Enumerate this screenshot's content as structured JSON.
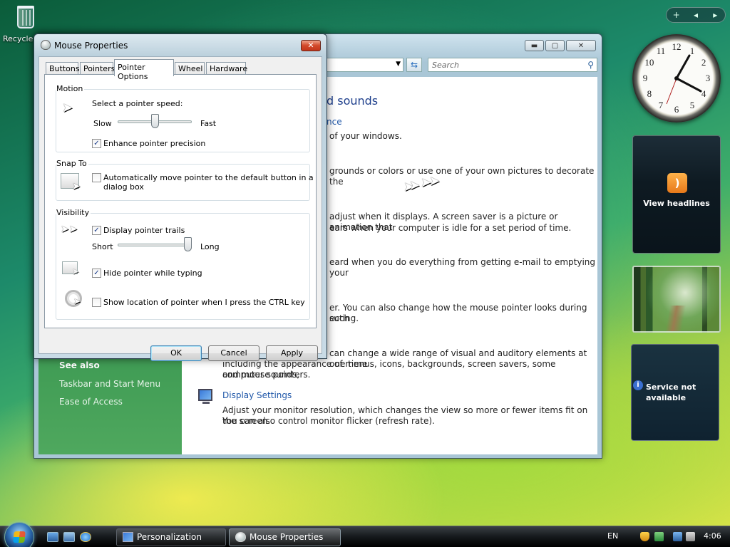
{
  "desktop": {
    "recycle_label": "Recycle"
  },
  "sidebar": {
    "controls": [
      "+",
      "◂",
      "▸"
    ],
    "clock_numbers": [
      "12",
      "1",
      "2",
      "3",
      "4",
      "5",
      "6",
      "7",
      "8",
      "9",
      "10",
      "11"
    ],
    "clock_time": "4:06",
    "news_label": "View headlines",
    "service_text": "Service not available"
  },
  "background_window": {
    "search_placeholder": "Search",
    "heading_fragment": "d sounds",
    "link_fragment": "nce",
    "lines": [
      "of your windows.",
      "grounds or colors or use one of your own pictures to decorate the",
      "adjust when it displays. A screen saver is a picture or animation that",
      "ears when your computer is idle for a set period of time.",
      "eard when you do everything from getting e-mail to emptying your",
      "er. You can also change how the mouse pointer looks during such",
      "ecting.",
      "can change a wide range of visual and auditory elements at one time",
      "including the appearance of menus, icons, backgrounds, screen savers, some computer sounds,",
      "and mouse pointers."
    ],
    "display_settings": {
      "title": "Display Settings",
      "desc1": "Adjust your monitor resolution, which changes the view so more or fewer items fit on the screen.",
      "desc2": "You can also control monitor flicker (refresh rate)."
    },
    "see_also": {
      "title": "See also",
      "links": [
        "Taskbar and Start Menu",
        "Ease of Access"
      ]
    }
  },
  "dialog": {
    "title": "Mouse Properties",
    "tabs": [
      "Buttons",
      "Pointers",
      "Pointer Options",
      "Wheel",
      "Hardware"
    ],
    "active_tab": "Pointer Options",
    "motion": {
      "label": "Motion",
      "speed_label": "Select a pointer speed:",
      "slow": "Slow",
      "fast": "Fast",
      "speed_level": 0.5,
      "enhance_label": "Enhance pointer precision",
      "enhance_checked": true
    },
    "snap_to": {
      "label": "Snap To",
      "auto_label_1": "Automatically move pointer to the default button in a",
      "auto_label_2": "dialog box",
      "auto_checked": false
    },
    "visibility": {
      "label": "Visibility",
      "trails_label": "Display pointer trails",
      "trails_checked": true,
      "short": "Short",
      "long": "Long",
      "trail_level": 1.0,
      "hide_label": "Hide pointer while typing",
      "hide_checked": true,
      "ctrl_label": "Show location of pointer when I press the CTRL key",
      "ctrl_checked": false
    },
    "buttons": {
      "ok": "OK",
      "cancel": "Cancel",
      "apply": "Apply"
    }
  },
  "taskbar": {
    "tasks": [
      {
        "label": "Personalization"
      },
      {
        "label": "Mouse Properties"
      }
    ],
    "language": "EN",
    "time": "4:06"
  },
  "colors": {
    "link_blue": "#1e56a8",
    "heading_blue": "#1e3f8c",
    "sidebar_green": "#4fa85e"
  }
}
